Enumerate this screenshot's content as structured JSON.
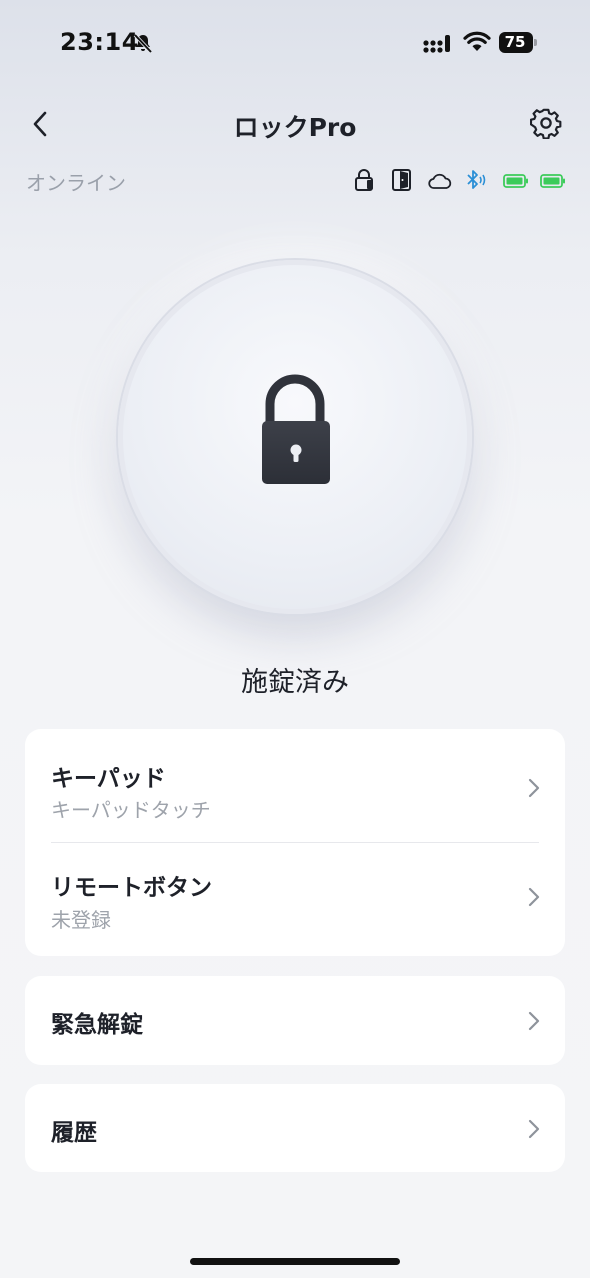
{
  "status_bar": {
    "time": "23:14",
    "battery_level": "75"
  },
  "nav": {
    "title": "ロックPro"
  },
  "device": {
    "online_label": "オンライン"
  },
  "lock": {
    "state_label": "施錠済み"
  },
  "menu": {
    "group1": [
      {
        "title": "キーパッド",
        "subtitle": "キーパッドタッチ"
      },
      {
        "title": "リモートボタン",
        "subtitle": "未登録"
      }
    ],
    "emergency_unlock": {
      "title": "緊急解錠"
    },
    "history": {
      "title": "履歴"
    }
  },
  "colors": {
    "bluetooth": "#2b8fd6",
    "battery_green": "#3ccb5a",
    "text_primary": "#1e2129",
    "text_secondary": "#9ea3ab"
  }
}
